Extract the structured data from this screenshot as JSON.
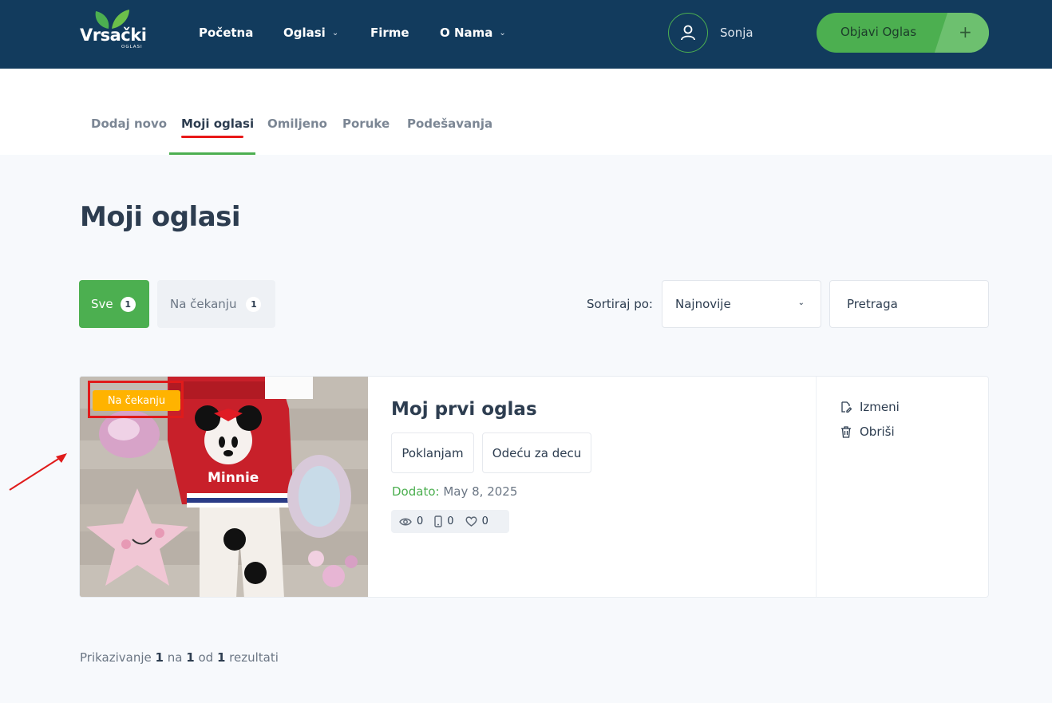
{
  "header": {
    "logo": {
      "word": "Vrsački",
      "sub": "OGLASI"
    },
    "nav": [
      {
        "label": "Početna",
        "has_dropdown": false
      },
      {
        "label": "Oglasi",
        "has_dropdown": true
      },
      {
        "label": "Firme",
        "has_dropdown": false
      },
      {
        "label": "O Nama",
        "has_dropdown": true
      }
    ],
    "user": {
      "name": "Sonja",
      "icon": "user-icon"
    },
    "post_button": {
      "label": "Objavi Oglas",
      "icon": "plus-icon"
    }
  },
  "subnav": {
    "tabs": [
      {
        "label": "Dodaj novo",
        "active": false
      },
      {
        "label": "Moji oglasi",
        "active": true
      },
      {
        "label": "Omiljeno",
        "active": false
      },
      {
        "label": "Poruke",
        "active": false
      },
      {
        "label": "Podešavanja",
        "active": false
      }
    ]
  },
  "page": {
    "title": "Moji oglasi"
  },
  "filters": {
    "all": {
      "label": "Sve",
      "count": "1"
    },
    "pending": {
      "label": "Na čekanju",
      "count": "1"
    },
    "sort_label": "Sortiraj po:",
    "sort_value": "Najnovije",
    "search_placeholder": "Pretraga"
  },
  "listing": {
    "status": "Na čekanju",
    "title": "Moj prvi oglas",
    "tags": [
      "Poklanjam",
      "Odeću za decu"
    ],
    "added_label": "Dodato:",
    "added_date": "May 8, 2025",
    "stats": {
      "views": "0",
      "phone": "0",
      "likes": "0"
    },
    "actions": {
      "edit": "Izmeni",
      "delete": "Obriši"
    },
    "image_text": "Minnie"
  },
  "results": {
    "prefix": "Prikazivanje",
    "from": "1",
    "mid": "na",
    "to": "1",
    "of": "od",
    "total": "1",
    "suffix": "rezultati"
  },
  "colors": {
    "header_bg": "#123b5d",
    "accent_green": "#4caf50",
    "status_amber": "#ffb300",
    "annotation_red": "#e01b1b"
  }
}
